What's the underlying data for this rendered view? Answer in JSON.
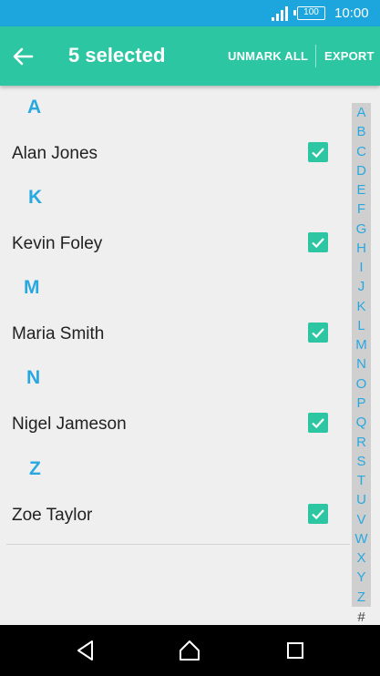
{
  "status_bar": {
    "battery": "100",
    "time": "10:00"
  },
  "action_bar": {
    "title": "5 selected",
    "unmark_label": "UNMARK ALL",
    "export_label": "EXPORT"
  },
  "sections": [
    {
      "letter": "A",
      "contacts": [
        {
          "name": "Alan Jones",
          "checked": true
        }
      ]
    },
    {
      "letter": "K",
      "contacts": [
        {
          "name": "Kevin Foley",
          "checked": true
        }
      ]
    },
    {
      "letter": "M",
      "contacts": [
        {
          "name": "Maria Smith",
          "checked": true
        }
      ]
    },
    {
      "letter": "N",
      "contacts": [
        {
          "name": "Nigel Jameson",
          "checked": true
        }
      ]
    },
    {
      "letter": "Z",
      "contacts": [
        {
          "name": "Zoe Taylor",
          "checked": true
        }
      ]
    }
  ],
  "index_letters": [
    "A",
    "B",
    "C",
    "D",
    "E",
    "F",
    "G",
    "H",
    "I",
    "J",
    "K",
    "L",
    "M",
    "N",
    "O",
    "P",
    "Q",
    "R",
    "S",
    "T",
    "U",
    "V",
    "W",
    "X",
    "Y",
    "Z"
  ],
  "index_hash": "#",
  "colors": {
    "status_bar": "#1da6de",
    "accent": "#2cc6a3",
    "section_letter": "#29a8e0"
  }
}
